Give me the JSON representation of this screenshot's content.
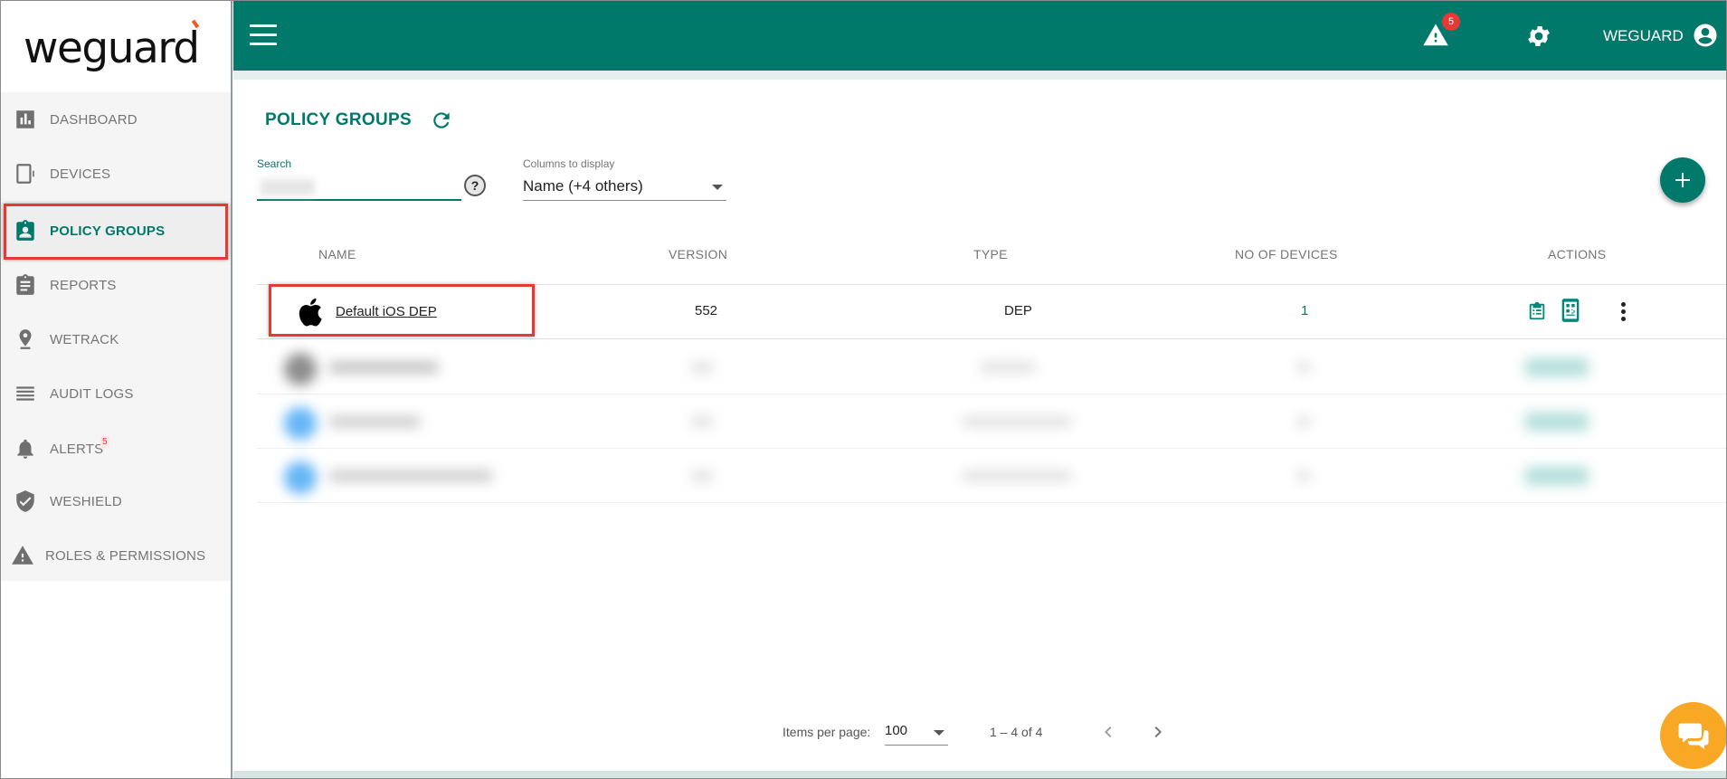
{
  "brand": {
    "logo_text": "weguard",
    "accent": "#00796b",
    "highlight": "#e53935"
  },
  "sidebar": {
    "items": [
      {
        "label": "DASHBOARD",
        "icon": "bar-chart-icon"
      },
      {
        "label": "DEVICES",
        "icon": "device-icon"
      },
      {
        "label": "POLICY GROUPS",
        "icon": "policy-badge-icon",
        "active": true
      },
      {
        "label": "REPORTS",
        "icon": "clipboard-icon"
      },
      {
        "label": "WETRACK",
        "icon": "location-pin-icon"
      },
      {
        "label": "AUDIT LOGS",
        "icon": "list-lines-icon"
      },
      {
        "label": "ALERTS",
        "icon": "bell-icon",
        "badge": "5"
      },
      {
        "label": "WESHIELD",
        "icon": "shield-check-icon"
      },
      {
        "label": "ROLES & PERMISSIONS",
        "icon": "warning-triangle-icon"
      }
    ]
  },
  "header": {
    "alerts_count": "5",
    "user_name": "WEGUARD"
  },
  "page": {
    "title": "POLICY GROUPS",
    "search_label": "Search",
    "search_value": "",
    "help_symbol": "?",
    "columns_label": "Columns to display",
    "columns_value": "Name (+4 others)"
  },
  "table": {
    "headers": [
      "NAME",
      "VERSION",
      "TYPE",
      "NO OF DEVICES",
      "ACTIONS"
    ],
    "rows": [
      {
        "name": "Default iOS DEP",
        "version": "552",
        "type": "DEP",
        "devices": "1",
        "os_icon": "apple-icon"
      }
    ]
  },
  "pagination": {
    "items_label": "Items per page:",
    "items_value": "100",
    "range": "1 – 4 of 4"
  }
}
